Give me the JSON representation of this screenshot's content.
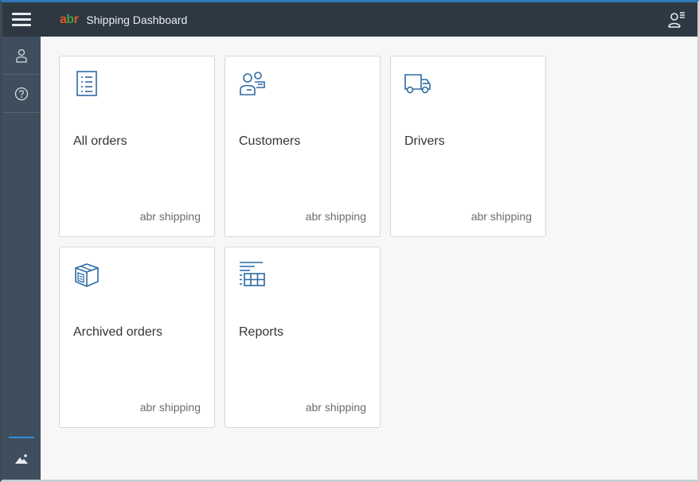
{
  "header": {
    "logo": {
      "part1": "a",
      "part2": "b",
      "part3": "r"
    },
    "title": "Shipping Dashboard"
  },
  "sidebar": {
    "items": [
      {
        "icon": "person-icon"
      },
      {
        "icon": "help-icon"
      }
    ],
    "bottom_icon": "image-icon"
  },
  "tiles": [
    {
      "title": "All orders",
      "footer": "abr shipping",
      "icon": "document-list-icon"
    },
    {
      "title": "Customers",
      "footer": "abr shipping",
      "icon": "customers-icon"
    },
    {
      "title": "Drivers",
      "footer": "abr shipping",
      "icon": "truck-icon"
    },
    {
      "title": "Archived orders",
      "footer": "abr shipping",
      "icon": "archive-box-icon"
    },
    {
      "title": "Reports",
      "footer": "abr shipping",
      "icon": "report-table-icon"
    }
  ],
  "colors": {
    "accent": "#2f79b8",
    "header": "#2d3843",
    "sidebar": "#3f4e5d",
    "icon": "#2d6aa3"
  }
}
